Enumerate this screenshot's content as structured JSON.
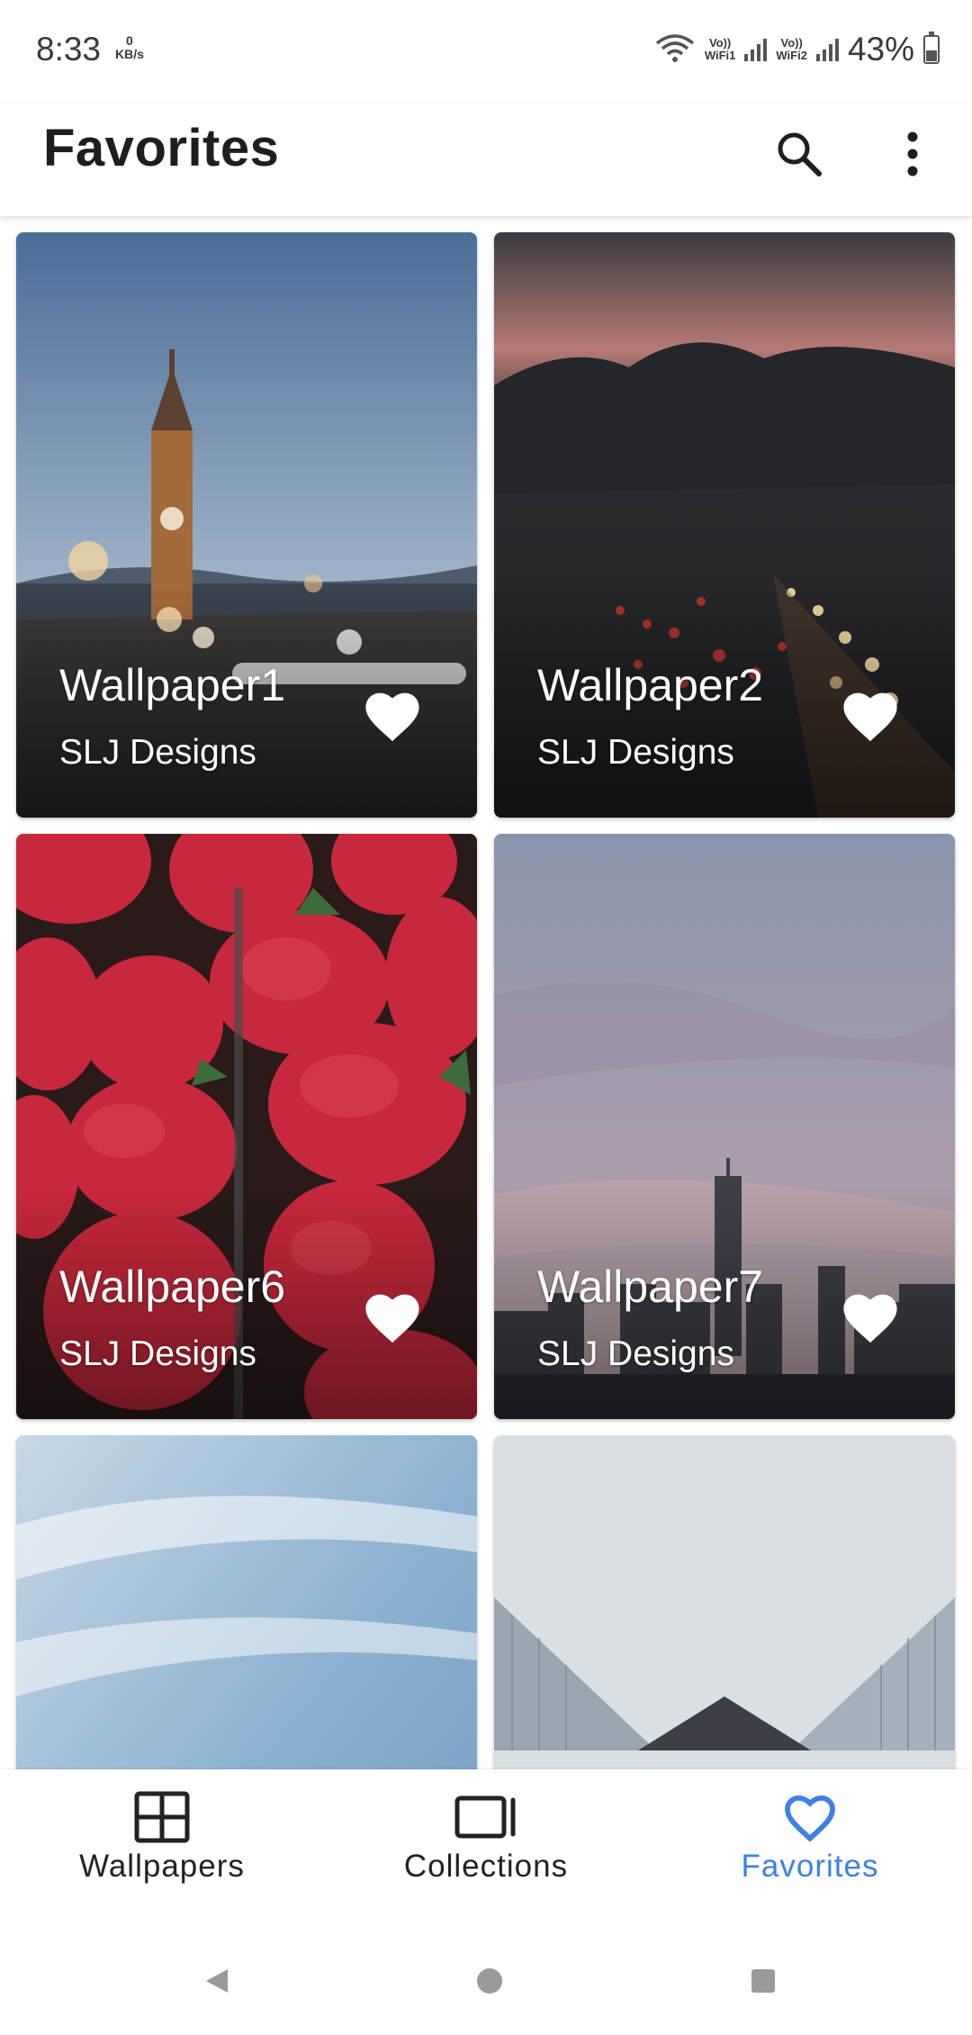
{
  "status_bar": {
    "time": "8:33",
    "net_speed_value": "0",
    "net_speed_unit": "KB/s",
    "sim1_label_top": "Vo))",
    "sim1_label_bottom": "WiFi1",
    "sim2_label_top": "Vo))",
    "sim2_label_bottom": "WiFi2",
    "battery": "43%",
    "battery_level": 0.43
  },
  "app_bar": {
    "title": "Favorites",
    "search_icon": "search-icon",
    "more_icon": "more-vert-icon"
  },
  "cards": [
    {
      "title": "Wallpaper1",
      "author": "SLJ Designs",
      "favorited": true,
      "scene": "big-ben-dusk"
    },
    {
      "title": "Wallpaper2",
      "author": "SLJ Designs",
      "favorited": true,
      "scene": "night-traffic"
    },
    {
      "title": "Wallpaper6",
      "author": "SLJ Designs",
      "favorited": true,
      "scene": "strawberries"
    },
    {
      "title": "Wallpaper7",
      "author": "SLJ Designs",
      "favorited": true,
      "scene": "city-skyline"
    },
    {
      "title": "",
      "author": "",
      "favorited": false,
      "scene": "blue-sky"
    },
    {
      "title": "",
      "author": "",
      "favorited": false,
      "scene": "glass-buildings"
    }
  ],
  "bottom_nav": {
    "items": [
      {
        "label": "Wallpapers",
        "icon": "grid-icon",
        "active": false
      },
      {
        "label": "Collections",
        "icon": "collections-icon",
        "active": false
      },
      {
        "label": "Favorites",
        "icon": "heart-icon",
        "active": true
      }
    ]
  },
  "colors": {
    "accent": "#3f7fe6",
    "text_primary": "#1e1e1e"
  }
}
